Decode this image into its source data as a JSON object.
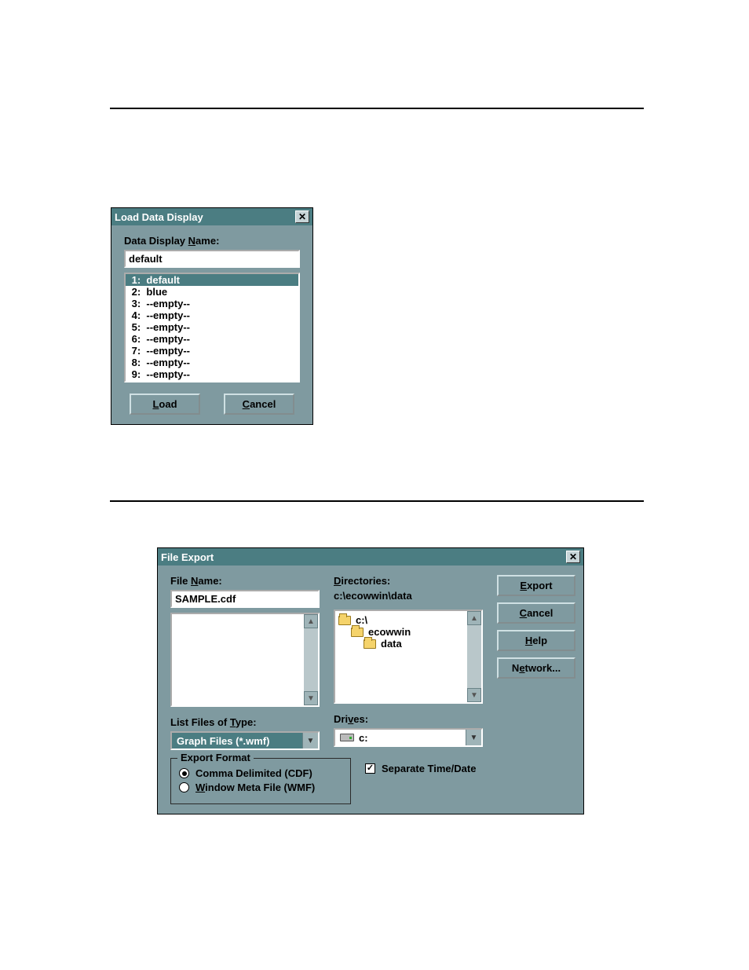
{
  "dialog1": {
    "title": "Load Data Display",
    "name_label_pre": "Data Display ",
    "name_label_u": "N",
    "name_label_post": "ame:",
    "name_value": "default",
    "items": [
      " 1:  default",
      " 2:  blue",
      " 3:  --empty--",
      " 4:  --empty--",
      " 5:  --empty--",
      " 6:  --empty--",
      " 7:  --empty--",
      " 8:  --empty--",
      " 9:  --empty--"
    ],
    "selected_index": 0,
    "load_u": "L",
    "load_rest": "oad",
    "cancel_u": "C",
    "cancel_rest": "ancel"
  },
  "dialog2": {
    "title": "File Export",
    "filename_label_pre": "File ",
    "filename_label_u": "N",
    "filename_label_post": "ame:",
    "filename_value": "SAMPLE.cdf",
    "dirs_label_u": "D",
    "dirs_label_rest": "irectories:",
    "dirs_path": "c:\\ecowwin\\data",
    "dir_items": [
      "c:\\",
      "ecowwin",
      "data"
    ],
    "type_label_pre": "List Files of ",
    "type_label_u": "T",
    "type_label_post": "ype:",
    "type_value": "Graph Files (*.wmf)",
    "drives_label_pre": "Dri",
    "drives_label_u": "v",
    "drives_label_post": "es:",
    "drive_value": "c:",
    "group_legend": "Export Format",
    "radio_cdf": "Comma Delimited (CDF)",
    "radio_cdf_selected": true,
    "radio_wmf_u": "W",
    "radio_wmf_rest": "indow Meta File (WMF)",
    "check_sep": "Separate Time/Date",
    "check_sep_checked": true,
    "btn_export_u": "E",
    "btn_export_rest": "xport",
    "btn_cancel_u": "C",
    "btn_cancel_rest": "ancel",
    "btn_help_u": "H",
    "btn_help_rest": "elp",
    "btn_network_pre": "N",
    "btn_network_u": "e",
    "btn_network_rest": "twork..."
  }
}
